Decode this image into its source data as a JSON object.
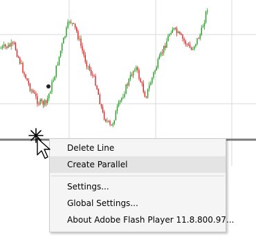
{
  "context_menu": {
    "items": [
      {
        "label": "Delete Line",
        "highlighted": false
      },
      {
        "label": "Create Parallel",
        "highlighted": true
      },
      {
        "label": "Settings...",
        "highlighted": false
      },
      {
        "label": "Global Settings...",
        "highlighted": false
      },
      {
        "label": "About Adobe Flash Player 11.8.800.97...",
        "highlighted": false
      }
    ]
  },
  "chart": {
    "up_color": "#1e9e1e",
    "down_color": "#e01e1e",
    "grid_color": "#d8d8d8",
    "separator_color": "#7a7a7a"
  },
  "icons": {
    "cursor": "crosshair-arrow-cursor"
  }
}
